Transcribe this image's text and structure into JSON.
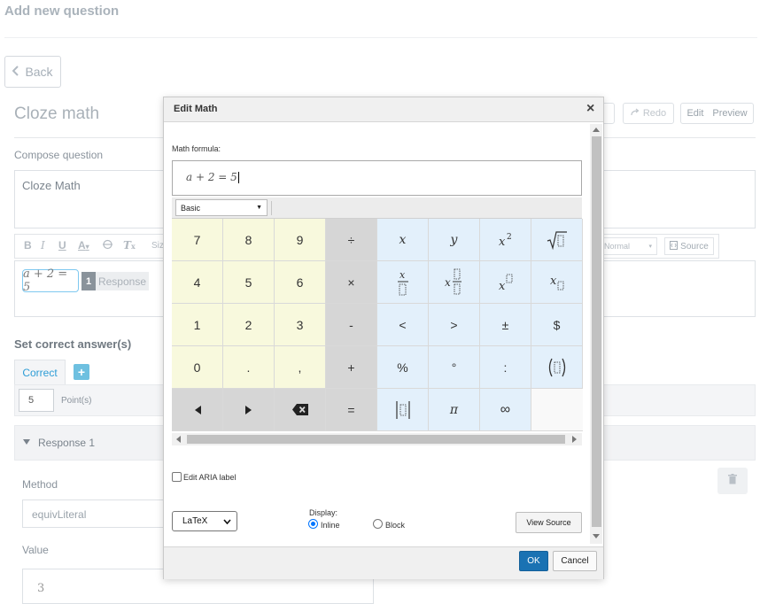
{
  "page": {
    "title": "Add new question"
  },
  "nav": {
    "back_label": "Back"
  },
  "question": {
    "type_title": "Cloze math"
  },
  "header_actions": {
    "redo_label": "Redo",
    "edit_label": "Edit",
    "preview_label": "Preview"
  },
  "compose": {
    "label": "Compose question",
    "text": "Cloze Math"
  },
  "editor_toolbar": {
    "size_label": "Siz",
    "normal_label": "Normal",
    "source_label": "Source"
  },
  "editor": {
    "math_chip": "a + 2  = 5",
    "response_number": "1",
    "response_label": "Response"
  },
  "answers": {
    "heading": "Set correct answer(s)",
    "tab_correct": "Correct",
    "add_symbol": "+",
    "points_value": "5",
    "points_label": "Point(s)",
    "response_title": "Response 1",
    "method_label": "Method",
    "method_value": "equivLiteral",
    "value_label": "Value",
    "value_text": "3"
  },
  "dialog": {
    "title": "Edit Math",
    "close_symbol": "×",
    "formula_label": "Math formula:",
    "formula_text": "a + 2  = 5",
    "group_select": "Basic",
    "keys": {
      "k7": "7",
      "k8": "8",
      "k9": "9",
      "divide": "÷",
      "x": "x",
      "y": "y",
      "k4": "4",
      "k5": "5",
      "k6": "6",
      "times": "×",
      "k1": "1",
      "k2": "2",
      "k3": "3",
      "minus": "-",
      "lt": "<",
      "gt": ">",
      "plusminus": "±",
      "dollar": "$",
      "k0": "0",
      "dot": ".",
      "comma": ",",
      "plus": "+",
      "percent": "%",
      "degree": "°",
      "colon": ":",
      "equals": "=",
      "pi": "π",
      "infinity": "∞"
    },
    "aria_label": "Edit ARIA label",
    "format_select": "LaTeX",
    "display_label": "Display:",
    "display_inline": "Inline",
    "display_block": "Block",
    "display_selected": "Inline",
    "view_source_label": "View Source",
    "ok_label": "OK",
    "cancel_label": "Cancel"
  },
  "colors": {
    "numpad_bg": "#f8f9dd",
    "operator_bg": "#d6d6d6",
    "symbol_bg": "#e3f0fb",
    "ok_button": "#1a72b3",
    "accent": "#2e9dd6"
  },
  "icons": [
    "chevron-left-icon",
    "redo-icon",
    "bold-icon",
    "italic-icon",
    "underline-icon",
    "font-color-icon",
    "strike-icon",
    "clear-format-icon",
    "source-icon",
    "trash-icon",
    "close-icon",
    "sqrt-icon",
    "fraction-icon",
    "power-icon",
    "subscript-icon",
    "parentheses-icon",
    "abs-icon",
    "arrow-left-icon",
    "arrow-right-icon",
    "backspace-icon"
  ]
}
